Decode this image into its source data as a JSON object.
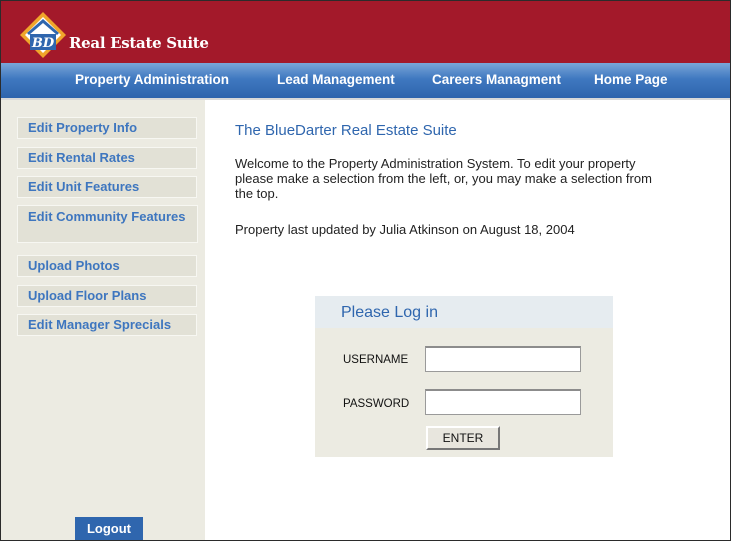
{
  "header": {
    "logo_text": "BD",
    "brand": "Real Estate Suite"
  },
  "nav": [
    {
      "label": "Property Administration"
    },
    {
      "label": "Lead Management"
    },
    {
      "label": "Careers Managment"
    },
    {
      "label": "Home Page"
    }
  ],
  "sidebar": {
    "items": [
      {
        "label": "Edit Property Info"
      },
      {
        "label": "Edit Rental Rates"
      },
      {
        "label": "Edit Unit Features"
      },
      {
        "label": "Edit Community Features"
      },
      {
        "label": "Upload Photos"
      },
      {
        "label": "Upload Floor Plans"
      },
      {
        "label": "Edit Manager Sprecials"
      }
    ],
    "logout_label": "Logout"
  },
  "main": {
    "title": "The BlueDarter Real Estate Suite",
    "welcome": "Welcome to the Property Administration System. To edit your property please make a selection from the left, or, you may make a selection from the top.",
    "updated": "Property last updated by Julia Atkinson on August 18, 2004"
  },
  "login": {
    "title": "Please Log in",
    "username_label": "USERNAME",
    "password_label": "PASSWORD",
    "username_value": "",
    "password_value": "",
    "enter_label": "ENTER"
  },
  "colors": {
    "header": "#a3192a",
    "nav": "#3f78c0",
    "accent": "#2f66ae",
    "sidebar": "#ecebe2"
  }
}
